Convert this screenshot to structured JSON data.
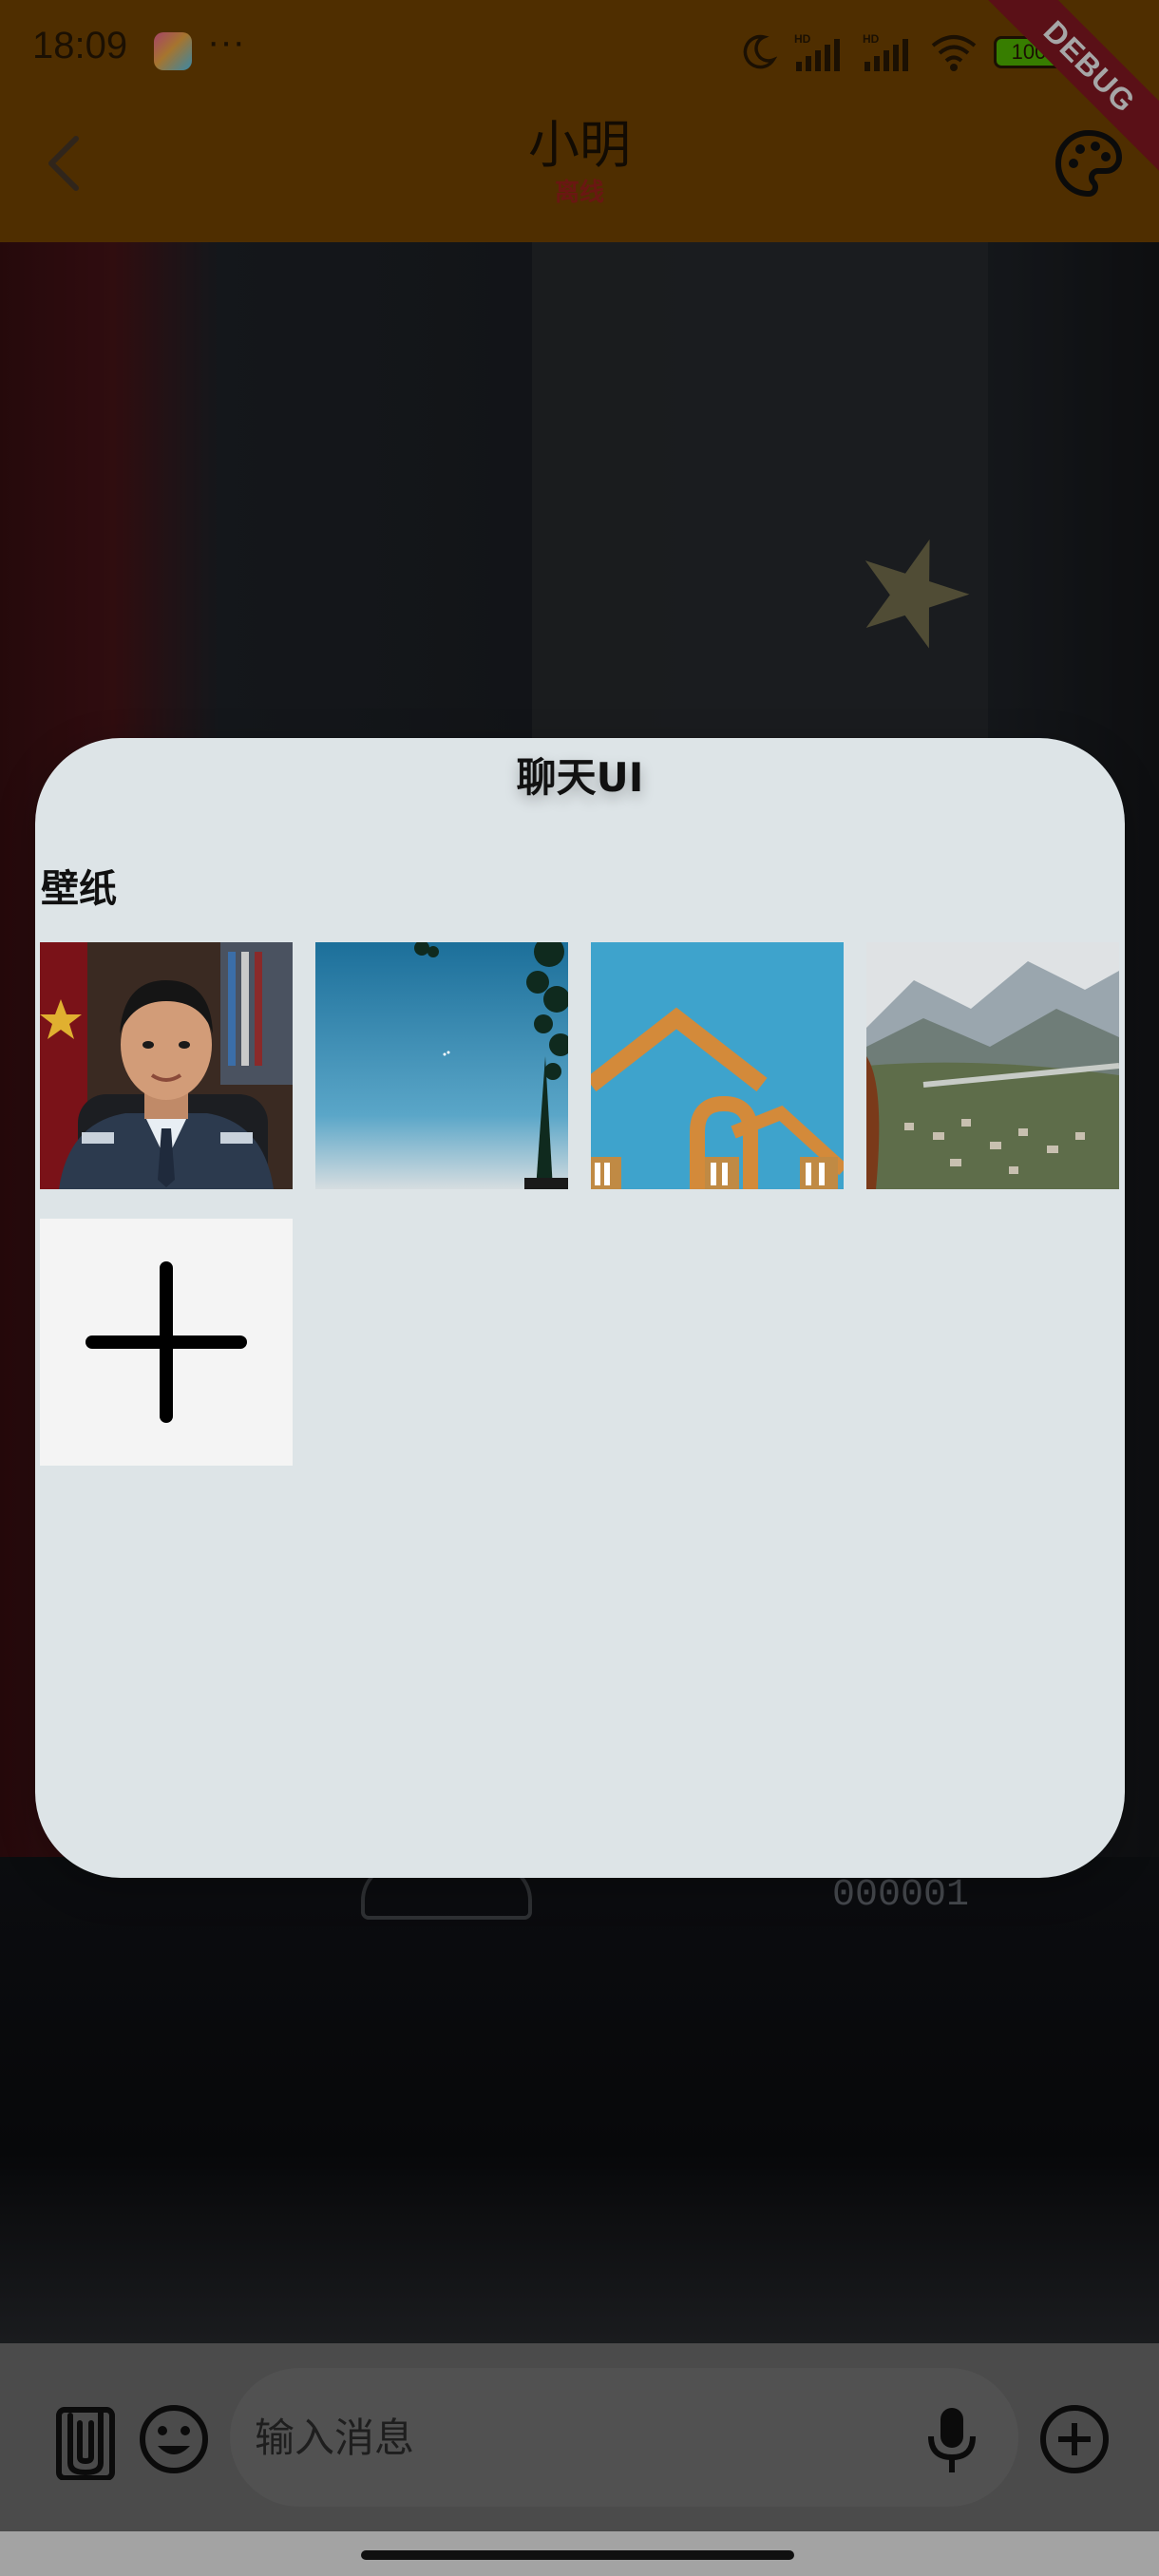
{
  "status_bar": {
    "time": "18:09",
    "more": "···",
    "battery": "100",
    "debug_label": "DEBUG"
  },
  "header": {
    "title": "小明",
    "subtitle": "离线"
  },
  "dialog": {
    "title": "聊天UI",
    "section_title": "壁纸",
    "wallpapers": [
      {
        "icon": "portrait-wallpaper"
      },
      {
        "icon": "sky-tree-wallpaper"
      },
      {
        "icon": "arch-building-wallpaper"
      },
      {
        "icon": "mountain-valley-wallpaper"
      }
    ],
    "add_icon": "plus-icon"
  },
  "background": {
    "badge_number": "000001"
  },
  "composer": {
    "placeholder": "输入消息"
  },
  "colors": {
    "appbar": "#7a4700",
    "offline": "#a3241d",
    "dialog": "#dde4e7",
    "input_bar": "#747474"
  }
}
